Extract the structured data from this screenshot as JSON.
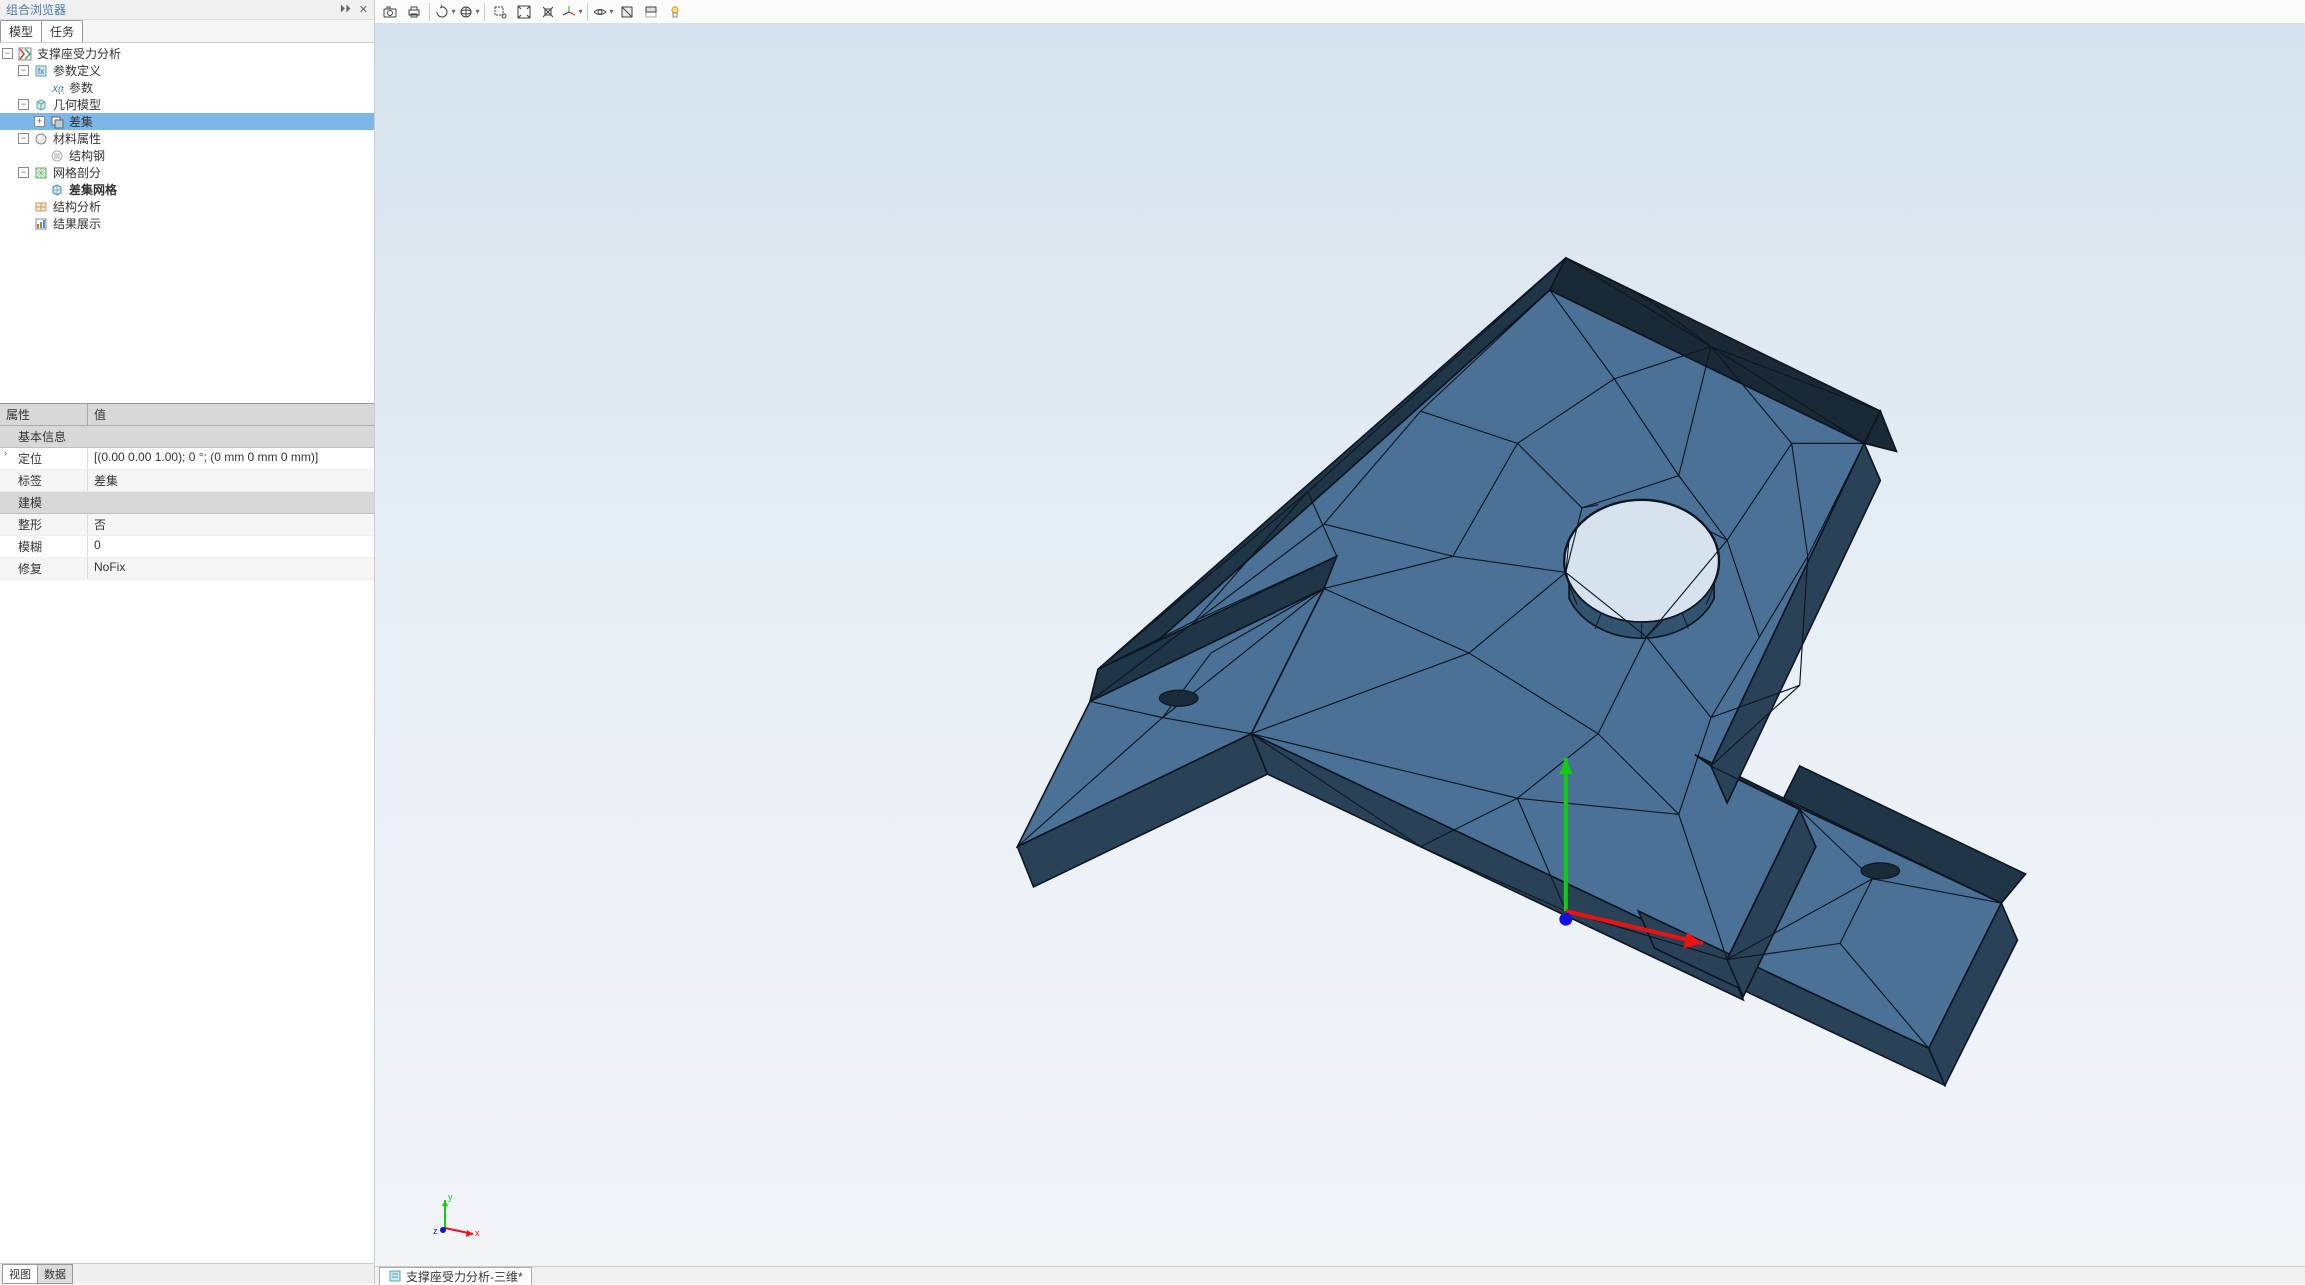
{
  "browser_panel": {
    "title": "组合浏览器",
    "tabs": {
      "model": "模型",
      "task": "任务"
    },
    "tree": {
      "root": "支撑座受力分析",
      "node_param_def": "参数定义",
      "node_param": "参数",
      "node_geom": "几何模型",
      "node_diff": "差集",
      "node_material": "材料属性",
      "node_steel": "结构钢",
      "node_mesh": "网格剖分",
      "node_diff_mesh": "差集网格",
      "node_struct_analysis": "结构分析",
      "node_result": "结果展示"
    },
    "bottom_tabs": {
      "view": "视图",
      "data": "数据"
    }
  },
  "properties": {
    "header_prop": "属性",
    "header_val": "值",
    "cat_basic": "基本信息",
    "row_position_label": "定位",
    "row_position_value": "[(0.00 0.00 1.00); 0 °; (0 mm  0 mm  0 mm)]",
    "row_label_label": "标签",
    "row_label_value": "差集",
    "cat_model": "建模",
    "row_shape_label": "整形",
    "row_shape_value": "否",
    "row_blur_label": "模糊",
    "row_blur_value": "0",
    "row_fix_label": "修复",
    "row_fix_value": "NoFix"
  },
  "doc_tab": "支撑座受力分析-三维*",
  "axes": {
    "x": "x",
    "y": "y",
    "z": "z"
  }
}
